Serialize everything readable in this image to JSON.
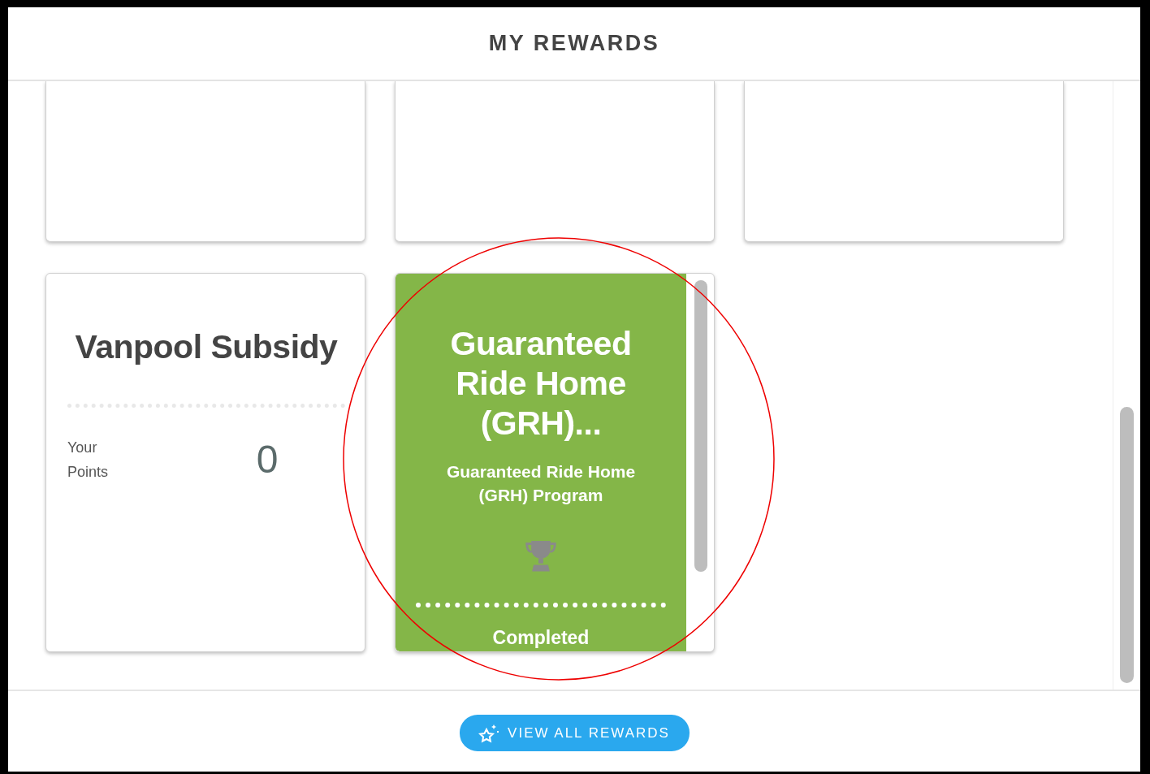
{
  "header": {
    "title": "MY REWARDS"
  },
  "cards": [
    {
      "kind": "blank"
    },
    {
      "kind": "blank"
    },
    {
      "kind": "blank"
    },
    {
      "kind": "points",
      "title": "Vanpool Subsidy",
      "points_label": "Your Points",
      "points": "0"
    },
    {
      "kind": "completed",
      "title": "Guaranteed Ride Home (GRH)...",
      "subtitle": "Guaranteed Ride Home (GRH) Program",
      "status": "Completed"
    }
  ],
  "button": {
    "label": "VIEW ALL REWARDS"
  }
}
